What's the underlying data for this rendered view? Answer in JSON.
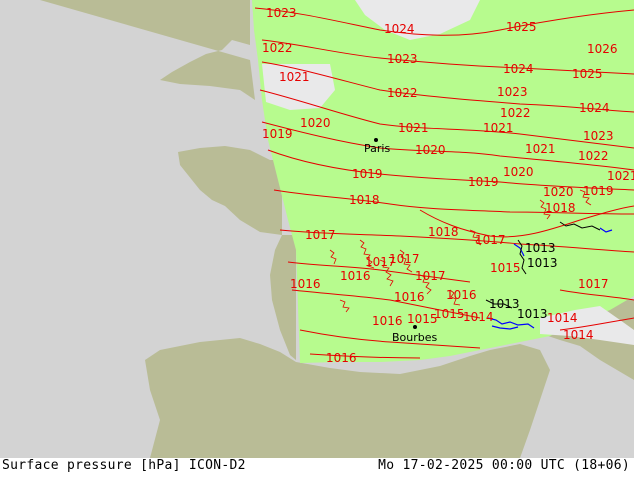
{
  "footer": {
    "title": "Surface pressure [hPa] ICON-D2",
    "datetime": "Mo 17-02-2025 00:00 UTC (18+06)"
  },
  "cities": [
    {
      "name": "Paris"
    },
    {
      "name": "Bourbes"
    }
  ],
  "isobar_labels": {
    "red": [
      "1023",
      "1024",
      "1025",
      "1026",
      "1022",
      "1023",
      "1024",
      "1025",
      "1021",
      "1022",
      "1023",
      "1024",
      "1020",
      "1021",
      "1022",
      "1023",
      "1019",
      "1021",
      "1021",
      "1022",
      "1020",
      "1020",
      "1021",
      "1019",
      "1019",
      "1020",
      "1019",
      "1018",
      "1018",
      "1017",
      "1018",
      "1017",
      "1016",
      "1017",
      "1016",
      "1017",
      "1016",
      "1015",
      "1014",
      "1016",
      "1015",
      "1014",
      "1017",
      "1016",
      "1014",
      "1015",
      "1016",
      "1017"
    ],
    "black": [
      "1013",
      "1013",
      "1013",
      "1013"
    ]
  },
  "colors": {
    "sea": "#d3d3d3",
    "land_outside": "#b9bc96",
    "model_domain": "#b7fb8e",
    "high_area": "#e9e9ea",
    "isobar": "#e60000",
    "low_isobar": "#0000ff"
  }
}
